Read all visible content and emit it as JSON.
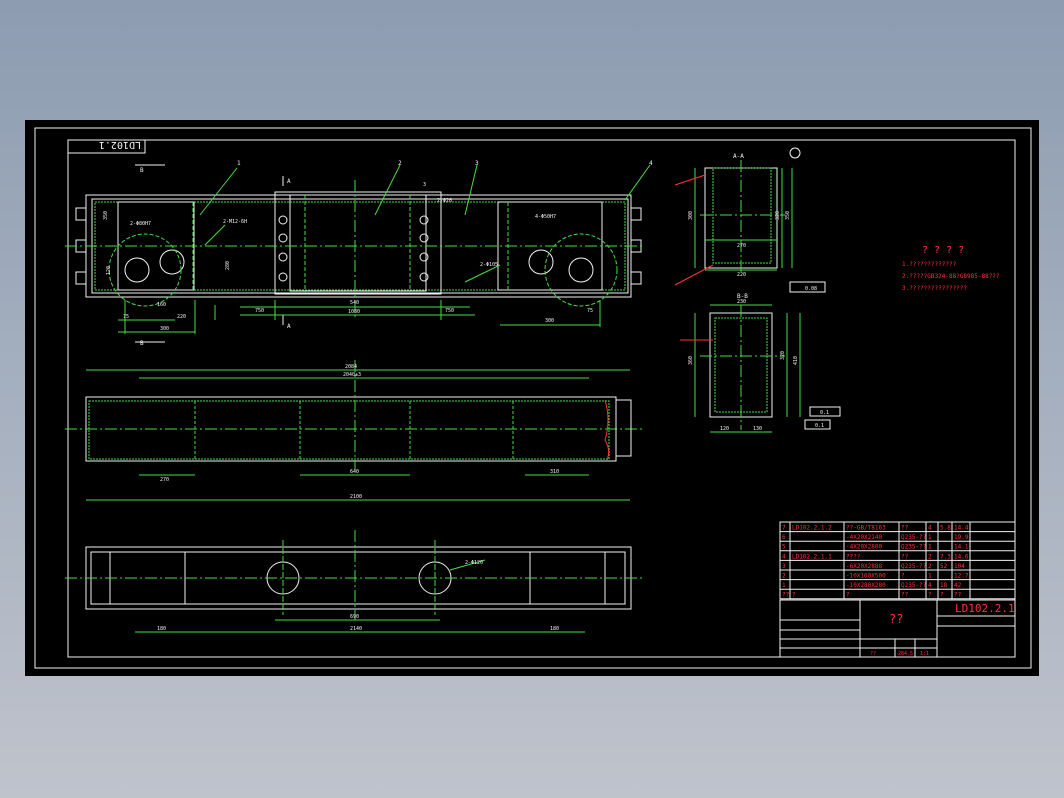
{
  "drawing_no_box": "LD102.1",
  "section_a_title": "A-A",
  "section_b_title": "B-B",
  "marker_b": "B",
  "marker_a": "A",
  "balloons": [
    "1",
    "2",
    "3",
    "4"
  ],
  "main_view": {
    "note_hole_left": "2-Φ80H7",
    "note_hole_right": "4-Φ50H7",
    "note_m12": "2-M12-6H",
    "note_4m8": "2-Φ20",
    "note_phi105": "2-Φ105",
    "note_3": "3",
    "dims_bottom": [
      "75",
      "220",
      "160",
      "300",
      "750",
      "540",
      "1080",
      "750",
      "300",
      "75"
    ],
    "dims_vertical": [
      "350",
      "280",
      "120"
    ]
  },
  "front_view": {
    "dim_total": "2084",
    "dim_inner": "2040±3",
    "dim_bottom": [
      "270",
      "640",
      "310"
    ],
    "dim_overall": "2100"
  },
  "bottom_view": {
    "note": "2-Φ120",
    "dims": [
      "180",
      "690",
      "2140",
      "180"
    ]
  },
  "section_a": {
    "dims": [
      "270",
      "220",
      "300",
      "350",
      "320"
    ],
    "tol": "0.08"
  },
  "section_b": {
    "dims": [
      "230",
      "320",
      "360",
      "120",
      "130",
      "410"
    ],
    "tol": [
      "0.1",
      "0.1"
    ]
  },
  "notes": {
    "title": "? ? ? ?",
    "lines": [
      "1.?????????????",
      "2.?????GB324-88?G8985-88???",
      "3.????????????????"
    ]
  },
  "parts_table": {
    "rows": [
      [
        "7",
        "LD102.2.1.2",
        "??-GB/T8163",
        "??",
        "4",
        "5.8",
        "14.4"
      ],
      [
        "6",
        "",
        "-4X20X2140",
        "Q235-??",
        "1",
        "",
        "19.9"
      ],
      [
        "5",
        "",
        "-4X20X2800",
        "Q235-??",
        "1",
        "",
        "14.1"
      ],
      [
        "4",
        "LD102.2.1.1",
        "????",
        "??",
        "2",
        "7.3",
        "14.6"
      ],
      [
        "3",
        "",
        "-6X20X2888",
        "Q235-??",
        "2",
        "52",
        "104"
      ],
      [
        "2",
        "",
        "-10X160X500",
        "?",
        "1",
        "",
        "12.7"
      ],
      [
        "1",
        "",
        "-10X280X280",
        "Q235-??",
        "4",
        "18",
        "42"
      ]
    ],
    "header": [
      "??",
      "?",
      "?",
      "??",
      "?",
      "?",
      "??"
    ]
  },
  "title_block": {
    "drawing_no": "LD102.2.1",
    "name": "??",
    "mass": "284.5",
    "scale": "1:1",
    "ratio": "??"
  }
}
